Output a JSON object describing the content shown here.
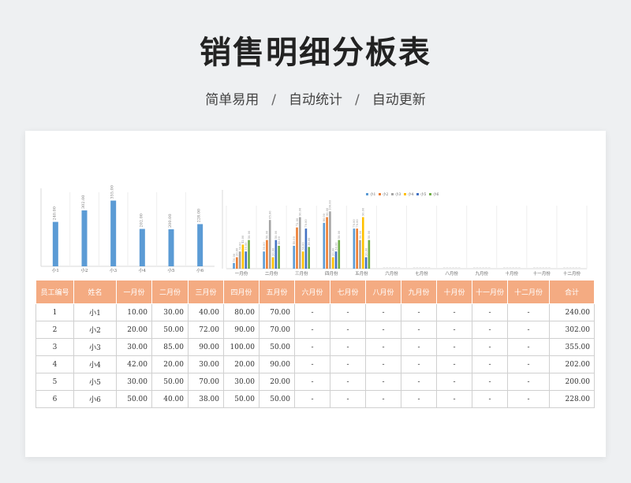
{
  "page": {
    "title": "销售明细分板表",
    "subtitle_items": [
      "简单易用",
      "自动统计",
      "自动更新"
    ],
    "subtitle_sep": "/"
  },
  "chart_data": [
    {
      "type": "bar",
      "categories": [
        "小1",
        "小2",
        "小3",
        "小4",
        "小5",
        "小6"
      ],
      "values": [
        240,
        302,
        355,
        202,
        200,
        228
      ],
      "data_labels": [
        "240.00",
        "302.00",
        "355.00",
        "202.00",
        "200.00",
        "228.00"
      ],
      "ylim": [
        0,
        400
      ],
      "colors": [
        "#5b9bd5"
      ]
    },
    {
      "type": "bar",
      "categories": [
        "一月份",
        "二月份",
        "三月份",
        "四月份",
        "五月份",
        "六月份",
        "七月份",
        "八月份",
        "九月份",
        "十月份",
        "十一月份",
        "十二月份"
      ],
      "legend_position": "top",
      "ylim": [
        0,
        110
      ],
      "series": [
        {
          "name": "小1",
          "color": "#5b9bd5",
          "values": [
            10,
            30,
            40,
            80,
            70,
            null,
            null,
            null,
            null,
            null,
            null,
            null
          ]
        },
        {
          "name": "小2",
          "color": "#ed7d31",
          "values": [
            20,
            50,
            72,
            90,
            70,
            null,
            null,
            null,
            null,
            null,
            null,
            null
          ]
        },
        {
          "name": "小3",
          "color": "#a5a5a5",
          "values": [
            30,
            85,
            90,
            100,
            50,
            null,
            null,
            null,
            null,
            null,
            null,
            null
          ]
        },
        {
          "name": "小4",
          "color": "#ffc000",
          "values": [
            42,
            20,
            30,
            20,
            90,
            null,
            null,
            null,
            null,
            null,
            null,
            null
          ]
        },
        {
          "name": "小5",
          "color": "#4472c4",
          "values": [
            30,
            50,
            70,
            30,
            20,
            null,
            null,
            null,
            null,
            null,
            null,
            null
          ]
        },
        {
          "name": "小6",
          "color": "#70ad47",
          "values": [
            50,
            40,
            38,
            50,
            50,
            null,
            null,
            null,
            null,
            null,
            null,
            null
          ]
        }
      ]
    }
  ],
  "table": {
    "headers": [
      "员工编号",
      "姓名",
      "一月份",
      "二月份",
      "三月份",
      "四月份",
      "五月份",
      "六月份",
      "七月份",
      "八月份",
      "九月份",
      "十月份",
      "十一月份",
      "十二月份",
      "合计"
    ],
    "rows": [
      [
        "1",
        "小1",
        "10.00",
        "30.00",
        "40.00",
        "80.00",
        "70.00",
        "-",
        "-",
        "-",
        "-",
        "-",
        "-",
        "-",
        "240.00"
      ],
      [
        "2",
        "小2",
        "20.00",
        "50.00",
        "72.00",
        "90.00",
        "70.00",
        "-",
        "-",
        "-",
        "-",
        "-",
        "-",
        "-",
        "302.00"
      ],
      [
        "3",
        "小3",
        "30.00",
        "85.00",
        "90.00",
        "100.00",
        "50.00",
        "-",
        "-",
        "-",
        "-",
        "-",
        "-",
        "-",
        "355.00"
      ],
      [
        "4",
        "小4",
        "42.00",
        "20.00",
        "30.00",
        "20.00",
        "90.00",
        "-",
        "-",
        "-",
        "-",
        "-",
        "-",
        "-",
        "202.00"
      ],
      [
        "5",
        "小5",
        "30.00",
        "50.00",
        "70.00",
        "30.00",
        "20.00",
        "-",
        "-",
        "-",
        "-",
        "-",
        "-",
        "-",
        "200.00"
      ],
      [
        "6",
        "小6",
        "50.00",
        "40.00",
        "38.00",
        "50.00",
        "50.00",
        "-",
        "-",
        "-",
        "-",
        "-",
        "-",
        "-",
        "228.00"
      ]
    ]
  }
}
